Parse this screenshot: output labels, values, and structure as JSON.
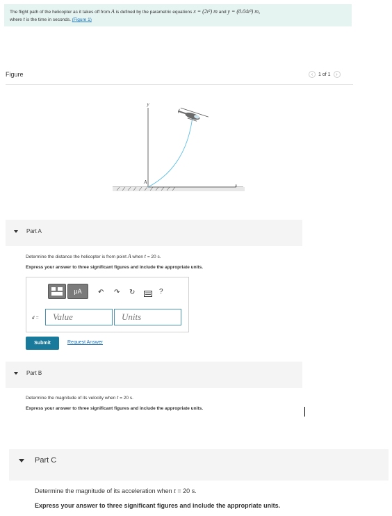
{
  "problem": {
    "line1_pre": "The flight path of the helicopter as it takes off from",
    "point": "A",
    "line1_mid": "is defined by the parametric equations",
    "x_eq": "x = (2t²) m",
    "line1_and": "and",
    "y_eq": "y = (0.04t³) m,",
    "line2_pre": "where",
    "t_var": "t",
    "line2_post": "is the time in seconds.",
    "figure_link": "(Figure 1)"
  },
  "figure": {
    "title": "Figure",
    "pager": "1 of 1",
    "prev_icon": "chevron-left-icon",
    "next_icon": "chevron-right-icon",
    "axis_y": "y",
    "axis_x": "x",
    "point_a": "A",
    "path_color": "#5bbde6"
  },
  "partA": {
    "label": "Part A",
    "question_pre": "Determine the distance the helicopter is from point",
    "question_point": "A",
    "question_mid": "when",
    "question_t": "t",
    "question_post": "= 20 s.",
    "instruction": "Express your answer to three significant figures and include the appropriate units.",
    "var_label": "d =",
    "value_placeholder": "Value",
    "units_placeholder": "Units",
    "toolbar": {
      "template_icon": "template-icon",
      "mu_label": "μA",
      "undo": "↶",
      "redo": "↷",
      "reset": "↻",
      "keyboard_icon": "keyboard-icon",
      "help": "?"
    },
    "submit": "Submit",
    "request": "Request Answer"
  },
  "partB": {
    "label": "Part B",
    "question_pre": "Determine the magnitude of its velocity when",
    "question_t": "t",
    "question_post": "= 20 s.",
    "instruction": "Express your answer to three significant figures and include the appropriate units."
  },
  "partC": {
    "label": "Part C",
    "question_pre": "Determine the magnitude of its acceleration when",
    "question_t": "t",
    "question_post": "= 20 s.",
    "instruction": "Express your answer to three significant figures and include the appropriate units."
  }
}
